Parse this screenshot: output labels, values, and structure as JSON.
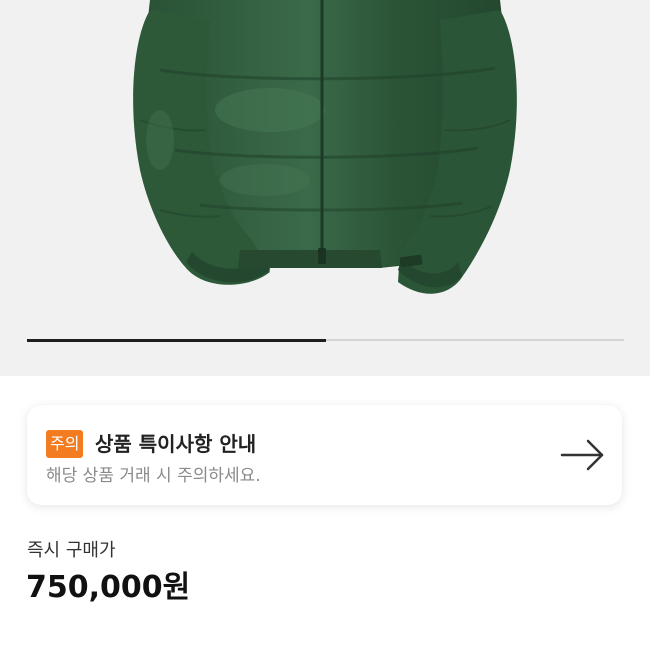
{
  "product": {
    "image_alt_icon": "down-jacket-image",
    "carousel": {
      "current": 1,
      "total": 2
    }
  },
  "notice": {
    "badge": "주의",
    "title": "상품 특이사항 안내",
    "subtitle": "해당 상품 거래 시 주의하세요.",
    "arrow_icon": "arrow-right-icon"
  },
  "price": {
    "label": "즉시 구매가",
    "value": "750,000원"
  },
  "colors": {
    "badge": "#f47c20",
    "jacket": "#2f5a3c",
    "background": "#f1f1f1"
  }
}
